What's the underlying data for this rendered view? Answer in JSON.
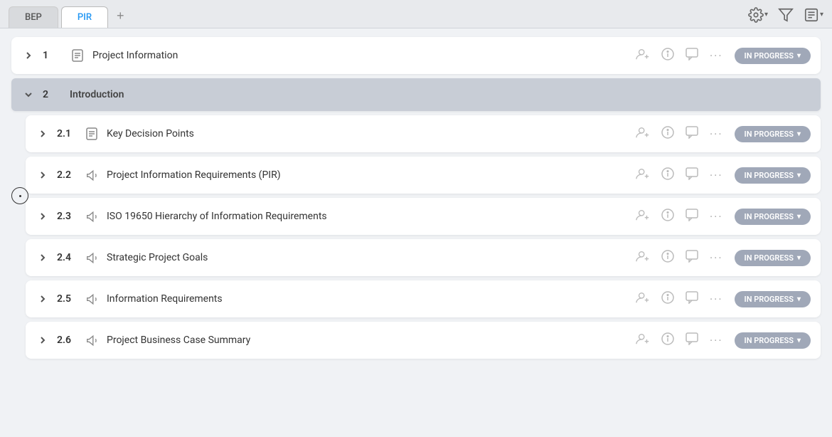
{
  "tabs": [
    {
      "id": "bep",
      "label": "BEP",
      "active": false
    },
    {
      "id": "pir",
      "label": "PIR",
      "active": true
    }
  ],
  "tab_add_label": "+",
  "toolbar": {
    "settings_icon": "gear-icon",
    "filter_icon": "filter-icon",
    "document_icon": "document-icon"
  },
  "rows": [
    {
      "id": "row-1",
      "number": "1",
      "icon_type": "document",
      "title": "Project Information",
      "status": "IN PROGRESS",
      "has_actions": true,
      "indent": 0,
      "expanded": false
    },
    {
      "id": "row-2",
      "number": "2",
      "icon_type": "none",
      "title": "Introduction",
      "status": "",
      "has_actions": false,
      "indent": 0,
      "expanded": true,
      "is_section": true
    },
    {
      "id": "row-2-1",
      "number": "2.1",
      "icon_type": "document",
      "title": "Key Decision Points",
      "status": "IN PROGRESS",
      "has_actions": true,
      "indent": 1
    },
    {
      "id": "row-2-2",
      "number": "2.2",
      "icon_type": "megaphone",
      "title": "Project Information Requirements (PIR)",
      "status": "IN PROGRESS",
      "has_actions": true,
      "indent": 1
    },
    {
      "id": "row-2-3",
      "number": "2.3",
      "icon_type": "megaphone",
      "title": "ISO 19650 Hierarchy of Information Requirements",
      "status": "IN PROGRESS",
      "has_actions": true,
      "indent": 1
    },
    {
      "id": "row-2-4",
      "number": "2.4",
      "icon_type": "megaphone",
      "title": "Strategic Project Goals",
      "status": "IN PROGRESS",
      "has_actions": true,
      "indent": 1
    },
    {
      "id": "row-2-5",
      "number": "2.5",
      "icon_type": "megaphone",
      "title": "Information Requirements",
      "status": "IN PROGRESS",
      "has_actions": true,
      "indent": 1
    },
    {
      "id": "row-2-6",
      "number": "2.6",
      "icon_type": "megaphone",
      "title": "Project Business Case Summary",
      "status": "IN PROGRESS",
      "has_actions": true,
      "indent": 1
    }
  ]
}
